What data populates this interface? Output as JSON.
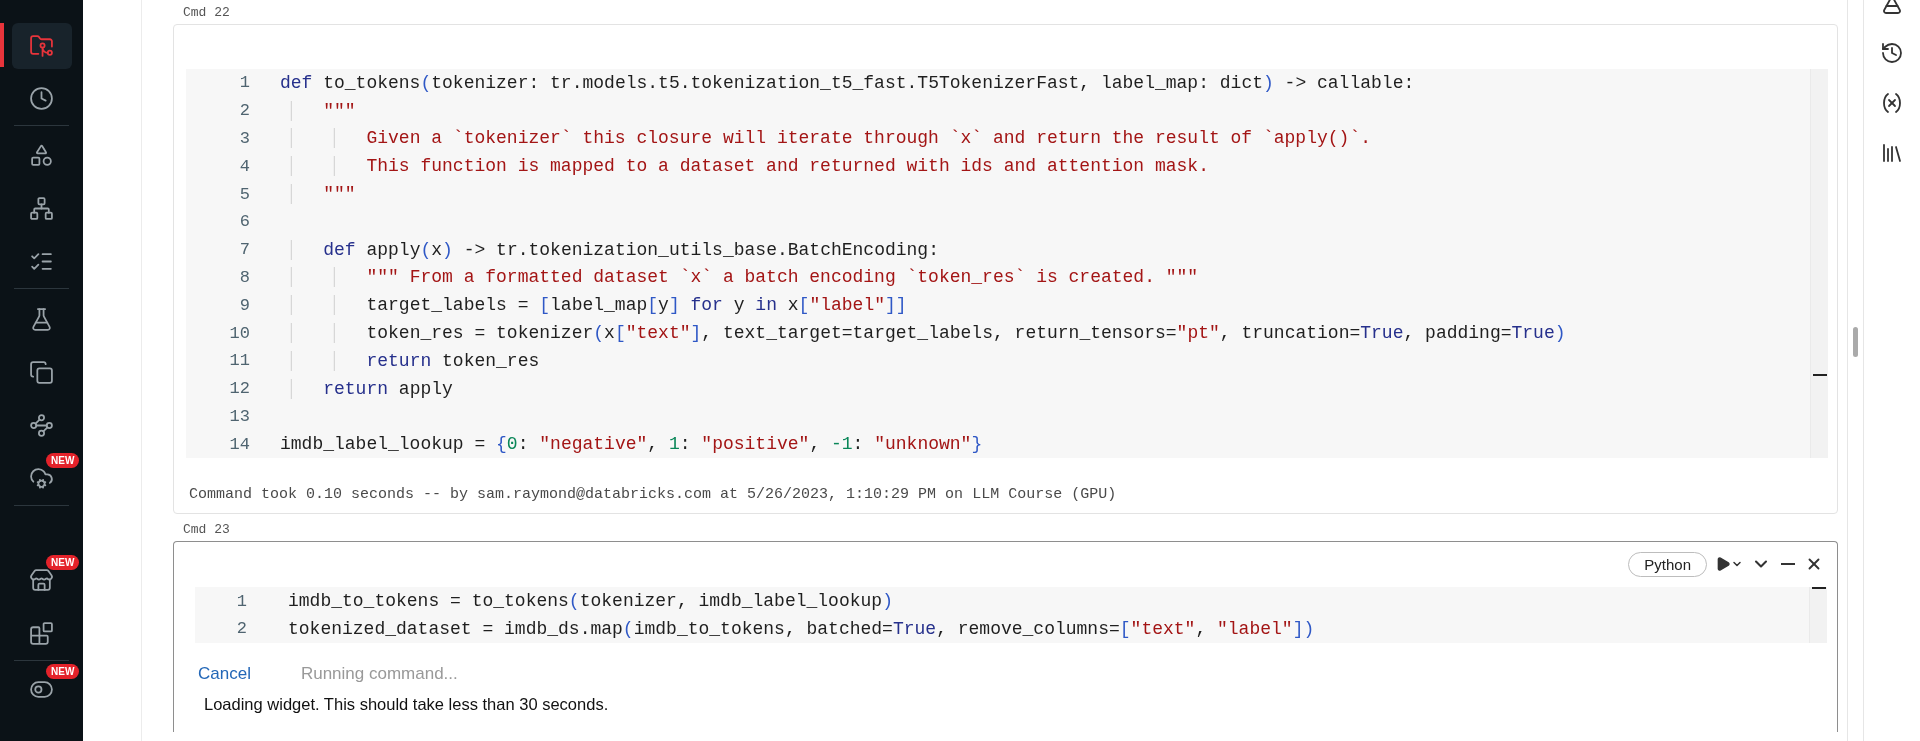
{
  "sidebar": {
    "groups": [
      {
        "items": [
          {
            "selected": true
          },
          {
            "selected": false
          }
        ]
      },
      {
        "items": [
          {
            "selected": false
          },
          {
            "selected": false
          },
          {
            "selected": false
          }
        ]
      },
      {
        "items": [
          {
            "selected": false
          },
          {
            "selected": false
          },
          {
            "selected": false
          },
          {
            "selected": false,
            "badge": "NEW"
          }
        ]
      },
      {
        "items": [
          {
            "selected": false,
            "badge": "NEW"
          },
          {
            "selected": false
          }
        ]
      },
      {
        "items": [
          {
            "selected": false,
            "badge": "NEW"
          }
        ]
      }
    ]
  },
  "cells": [
    {
      "label": "Cmd 22",
      "selected": false,
      "lines": [
        {
          "number": "1",
          "tokens": [
            {
              "kind": "kw",
              "text": "def"
            },
            {
              "kind": "plain",
              "text": " to_tokens"
            },
            {
              "kind": "punct",
              "text": "("
            },
            {
              "kind": "plain",
              "text": "tokenizer: tr.models.t5.tokenization_t5_fast.T5TokenizerFast, label_map: dict"
            },
            {
              "kind": "punct",
              "text": ")"
            },
            {
              "kind": "plain",
              "text": " -> callable:"
            }
          ]
        },
        {
          "number": "2",
          "tokens": [
            {
              "kind": "str",
              "text": "    \"\"\""
            }
          ]
        },
        {
          "number": "3",
          "tokens": [
            {
              "kind": "str",
              "text": "        Given a `tokenizer` this closure will iterate through `x` and return the result of `apply()`."
            }
          ]
        },
        {
          "number": "4",
          "tokens": [
            {
              "kind": "str",
              "text": "        This function is mapped to a dataset and returned with ids and attention mask."
            }
          ]
        },
        {
          "number": "5",
          "tokens": [
            {
              "kind": "str",
              "text": "    \"\"\""
            }
          ]
        },
        {
          "number": "6"
        },
        {
          "number": "7",
          "tokens": [
            {
              "kind": "kw",
              "text": "    def"
            },
            {
              "kind": "plain",
              "text": " apply"
            },
            {
              "kind": "punct",
              "text": "("
            },
            {
              "kind": "plain",
              "text": "x"
            },
            {
              "kind": "punct",
              "text": ")"
            },
            {
              "kind": "plain",
              "text": " -> tr.tokenization_utils_base.BatchEncoding:"
            }
          ]
        },
        {
          "number": "8",
          "tokens": [
            {
              "kind": "str",
              "text": "        \"\"\" From a formatted dataset `x` a batch encoding `token_res` is created. \"\"\""
            }
          ]
        },
        {
          "number": "9",
          "tokens": [
            {
              "kind": "plain",
              "text": "        target_labels = "
            },
            {
              "kind": "punct",
              "text": "["
            },
            {
              "kind": "plain",
              "text": "label_map"
            },
            {
              "kind": "punct",
              "text": "["
            },
            {
              "kind": "plain",
              "text": "y"
            },
            {
              "kind": "punct",
              "text": "]"
            },
            {
              "kind": "kw",
              "text": " for"
            },
            {
              "kind": "plain",
              "text": " y "
            },
            {
              "kind": "kw",
              "text": "in"
            },
            {
              "kind": "plain",
              "text": " x"
            },
            {
              "kind": "punct",
              "text": "["
            },
            {
              "kind": "str",
              "text": "\"label\""
            },
            {
              "kind": "punct",
              "text": "]]"
            }
          ]
        },
        {
          "number": "10",
          "tokens": [
            {
              "kind": "plain",
              "text": "        token_res = tokenizer"
            },
            {
              "kind": "punct",
              "text": "("
            },
            {
              "kind": "plain",
              "text": "x"
            },
            {
              "kind": "punct",
              "text": "["
            },
            {
              "kind": "str",
              "text": "\"text\""
            },
            {
              "kind": "punct",
              "text": "]"
            },
            {
              "kind": "plain",
              "text": ", text_target=target_labels, return_tensors="
            },
            {
              "kind": "str",
              "text": "\"pt\""
            },
            {
              "kind": "plain",
              "text": ", truncation="
            },
            {
              "kind": "kw",
              "text": "True"
            },
            {
              "kind": "plain",
              "text": ", padding="
            },
            {
              "kind": "kw",
              "text": "True"
            },
            {
              "kind": "punct",
              "text": ")"
            }
          ]
        },
        {
          "number": "11",
          "tokens": [
            {
              "kind": "kw",
              "text": "        return"
            },
            {
              "kind": "plain",
              "text": " token_res"
            }
          ]
        },
        {
          "number": "12",
          "tokens": [
            {
              "kind": "kw",
              "text": "    return"
            },
            {
              "kind": "plain",
              "text": " apply"
            }
          ]
        },
        {
          "number": "13"
        },
        {
          "number": "14",
          "tokens": [
            {
              "kind": "plain",
              "text": "imdb_label_lookup = "
            },
            {
              "kind": "punct",
              "text": "{"
            },
            {
              "kind": "num",
              "text": "0"
            },
            {
              "kind": "plain",
              "text": ": "
            },
            {
              "kind": "str",
              "text": "\"negative\""
            },
            {
              "kind": "plain",
              "text": ", "
            },
            {
              "kind": "num",
              "text": "1"
            },
            {
              "kind": "plain",
              "text": ": "
            },
            {
              "kind": "str",
              "text": "\"positive\""
            },
            {
              "kind": "plain",
              "text": ", "
            },
            {
              "kind": "num",
              "text": "-1"
            },
            {
              "kind": "plain",
              "text": ": "
            },
            {
              "kind": "str",
              "text": "\"unknown\""
            },
            {
              "kind": "punct",
              "text": "}"
            }
          ]
        }
      ],
      "footer": "Command took 0.10 seconds -- by sam.raymond@databricks.com at 5/26/2023, 1:10:29 PM on LLM Course (GPU)"
    },
    {
      "label": "Cmd 23",
      "selected": true,
      "language": "Python",
      "lines": [
        {
          "number": "1",
          "tokens": [
            {
              "kind": "plain",
              "text": "imdb_to_tokens = to_tokens"
            },
            {
              "kind": "punct",
              "text": "("
            },
            {
              "kind": "plain",
              "text": "tokenizer, imdb_label_lookup"
            },
            {
              "kind": "punct",
              "text": ")"
            }
          ]
        },
        {
          "number": "2",
          "tokens": [
            {
              "kind": "plain",
              "text": "tokenized_dataset = imdb_ds.map"
            },
            {
              "kind": "punct",
              "text": "("
            },
            {
              "kind": "plain",
              "text": "imdb_to_tokens, batched="
            },
            {
              "kind": "kw",
              "text": "True"
            },
            {
              "kind": "plain",
              "text": ", remove_columns="
            },
            {
              "kind": "punct",
              "text": "["
            },
            {
              "kind": "str",
              "text": "\"text\""
            },
            {
              "kind": "plain",
              "text": ", "
            },
            {
              "kind": "str",
              "text": "\"label\""
            },
            {
              "kind": "punct",
              "text": "])"
            }
          ]
        }
      ],
      "cancel": "Cancel",
      "status": "Running command...",
      "message": "Loading widget. This should take less than 30 seconds."
    }
  ]
}
